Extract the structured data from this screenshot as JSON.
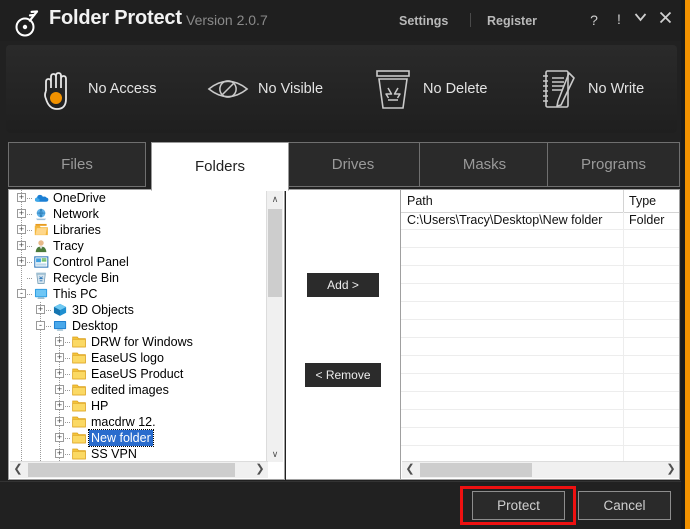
{
  "titlebar": {
    "app_name": "Folder Protect",
    "version": "Version 2.0.7",
    "logo_icon": "key-icon",
    "links": [
      {
        "label": "Settings",
        "name": "settings-link"
      },
      {
        "label": "Register",
        "name": "register-link"
      }
    ],
    "buttons": [
      {
        "label": "?",
        "name": "help-button"
      },
      {
        "label": "!",
        "name": "alert-button"
      },
      {
        "label": "⌄",
        "name": "minimize-button"
      },
      {
        "label": "✕",
        "name": "close-button"
      }
    ]
  },
  "modes": [
    {
      "label": "No Access",
      "icon": "hand-icon"
    },
    {
      "label": "No Visible",
      "icon": "eye-slash-icon"
    },
    {
      "label": "No Delete",
      "icon": "recycle-bin-icon"
    },
    {
      "label": "No Write",
      "icon": "notepad-pencil-icon"
    }
  ],
  "tabs": [
    {
      "label": "Files",
      "active": false
    },
    {
      "label": "Folders",
      "active": true
    },
    {
      "label": "Drives",
      "active": false
    },
    {
      "label": "Masks",
      "active": false
    },
    {
      "label": "Programs",
      "active": false
    }
  ],
  "tree": {
    "nodes": [
      {
        "label": "OneDrive",
        "depth": 0,
        "expander": "+",
        "icon": "onedrive-cloud-icon",
        "selected": false
      },
      {
        "label": "Network",
        "depth": 0,
        "expander": "+",
        "icon": "network-icon",
        "selected": false
      },
      {
        "label": "Libraries",
        "depth": 0,
        "expander": "+",
        "icon": "libraries-icon",
        "selected": false
      },
      {
        "label": "Tracy",
        "depth": 0,
        "expander": "+",
        "icon": "user-icon",
        "selected": false
      },
      {
        "label": "Control Panel",
        "depth": 0,
        "expander": "+",
        "icon": "control-panel-icon",
        "selected": false
      },
      {
        "label": "Recycle Bin",
        "depth": 0,
        "expander": "",
        "icon": "recycle-bin-icon",
        "selected": false
      },
      {
        "label": "This PC",
        "depth": 0,
        "expander": "-",
        "icon": "this-pc-icon",
        "selected": false
      },
      {
        "label": "3D Objects",
        "depth": 1,
        "expander": "+",
        "icon": "3d-objects-icon",
        "selected": false
      },
      {
        "label": "Desktop",
        "depth": 1,
        "expander": "-",
        "icon": "desktop-icon",
        "selected": false
      },
      {
        "label": "DRW for Windows",
        "depth": 2,
        "expander": "+",
        "icon": "folder-icon",
        "selected": false
      },
      {
        "label": "EaseUS logo",
        "depth": 2,
        "expander": "+",
        "icon": "folder-icon",
        "selected": false
      },
      {
        "label": "EaseUS Product",
        "depth": 2,
        "expander": "+",
        "icon": "folder-icon",
        "selected": false
      },
      {
        "label": "edited images",
        "depth": 2,
        "expander": "+",
        "icon": "folder-icon",
        "selected": false
      },
      {
        "label": "HP",
        "depth": 2,
        "expander": "+",
        "icon": "folder-icon",
        "selected": false
      },
      {
        "label": "macdrw 12.",
        "depth": 2,
        "expander": "+",
        "icon": "folder-icon",
        "selected": false
      },
      {
        "label": "New folder",
        "depth": 2,
        "expander": "+",
        "icon": "folder-icon",
        "selected": true
      },
      {
        "label": "SS  VPN",
        "depth": 2,
        "expander": "+",
        "icon": "folder-icon",
        "selected": false
      }
    ],
    "scroll_left_arrow": "❮",
    "scroll_right_arrow": "❯",
    "scroll_up_arrow": "∧",
    "scroll_down_arrow": "∨"
  },
  "transfer": {
    "add_label": "Add >",
    "remove_label": "< Remove"
  },
  "list": {
    "columns": [
      "Path",
      "Type"
    ],
    "rows": [
      {
        "path": "C:\\Users\\Tracy\\Desktop\\New folder",
        "type": "Folder"
      }
    ],
    "empty_row_count": 13,
    "scroll_left_arrow": "❮",
    "scroll_right_arrow": "❯"
  },
  "footer": {
    "protect_label": "Protect",
    "cancel_label": "Cancel"
  },
  "colors": {
    "accent_orange": "#f29200",
    "window_dark": "#212121",
    "selection_blue": "#2a6ccd",
    "annotation_red": "#ee1111"
  }
}
